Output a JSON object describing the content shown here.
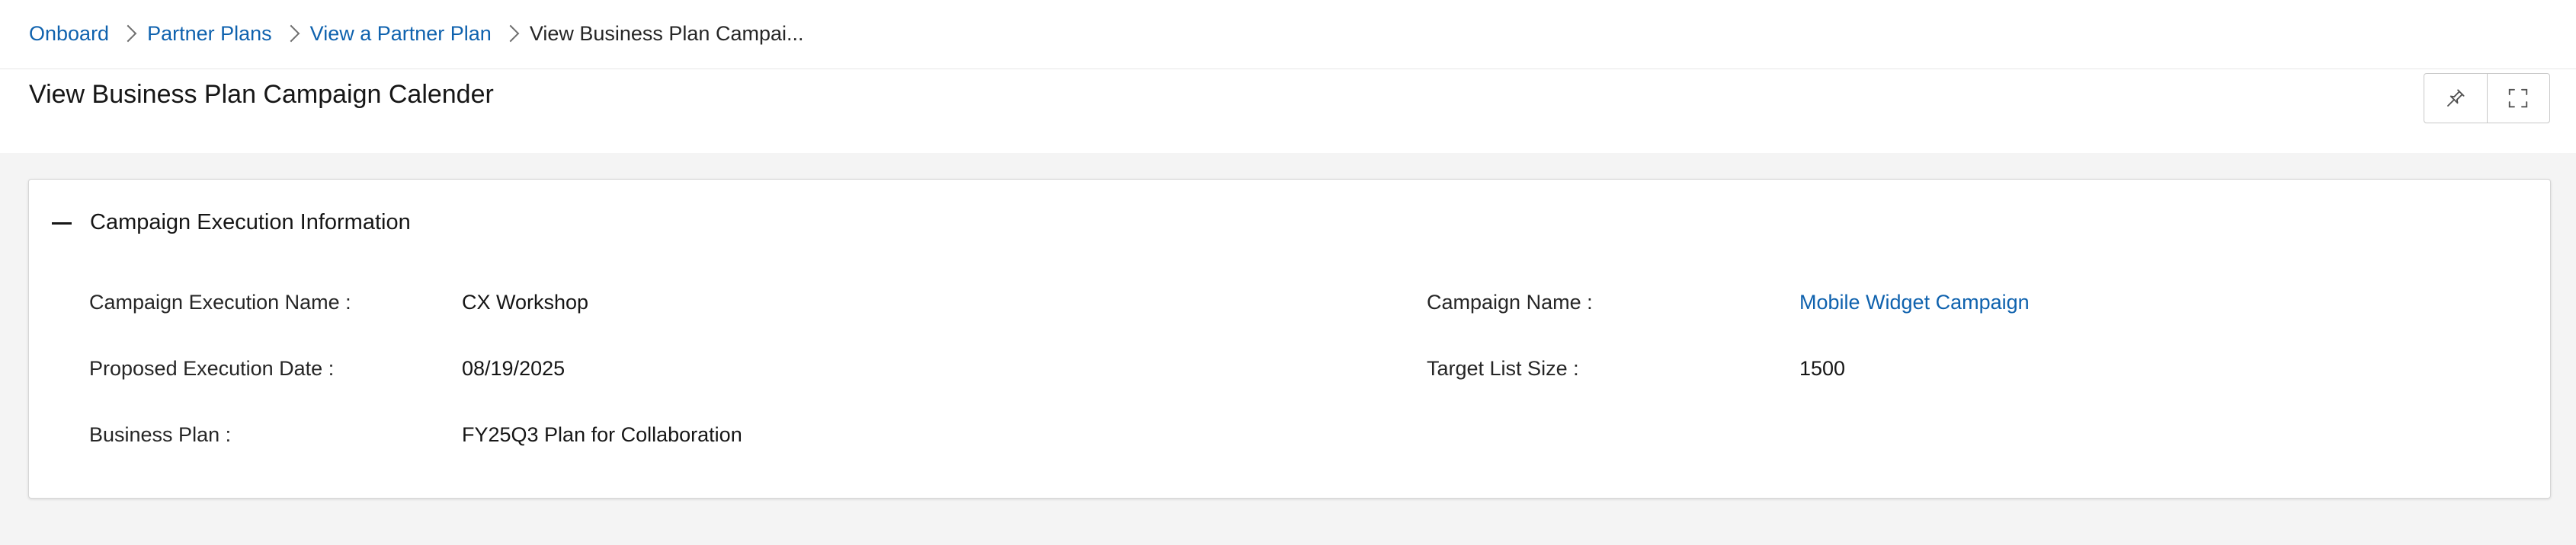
{
  "breadcrumb": {
    "items": [
      "Onboard",
      "Partner Plans",
      "View a Partner Plan"
    ],
    "current": "View Business Plan Campai..."
  },
  "page": {
    "title": "View Business Plan Campaign Calender"
  },
  "toolbar": {
    "pin_icon": "pin-icon",
    "expand_icon": "fullscreen-icon"
  },
  "section": {
    "title": "Campaign Execution Information",
    "collapse_icon": "minus-icon",
    "fields": {
      "execution_name": {
        "label": "Campaign Execution Name :",
        "value": "CX Workshop"
      },
      "campaign_name": {
        "label": "Campaign Name :",
        "value": "Mobile Widget Campaign"
      },
      "proposed_date": {
        "label": "Proposed Execution Date :",
        "value": "08/19/2025"
      },
      "target_list_size": {
        "label": "Target List Size :",
        "value": "1500"
      },
      "business_plan": {
        "label": "Business Plan :",
        "value": "FY25Q3 Plan for Collaboration"
      }
    }
  },
  "colors": {
    "link": "#0f62ae",
    "text": "#161616",
    "background": "#f4f4f4",
    "panel": "#ffffff"
  }
}
